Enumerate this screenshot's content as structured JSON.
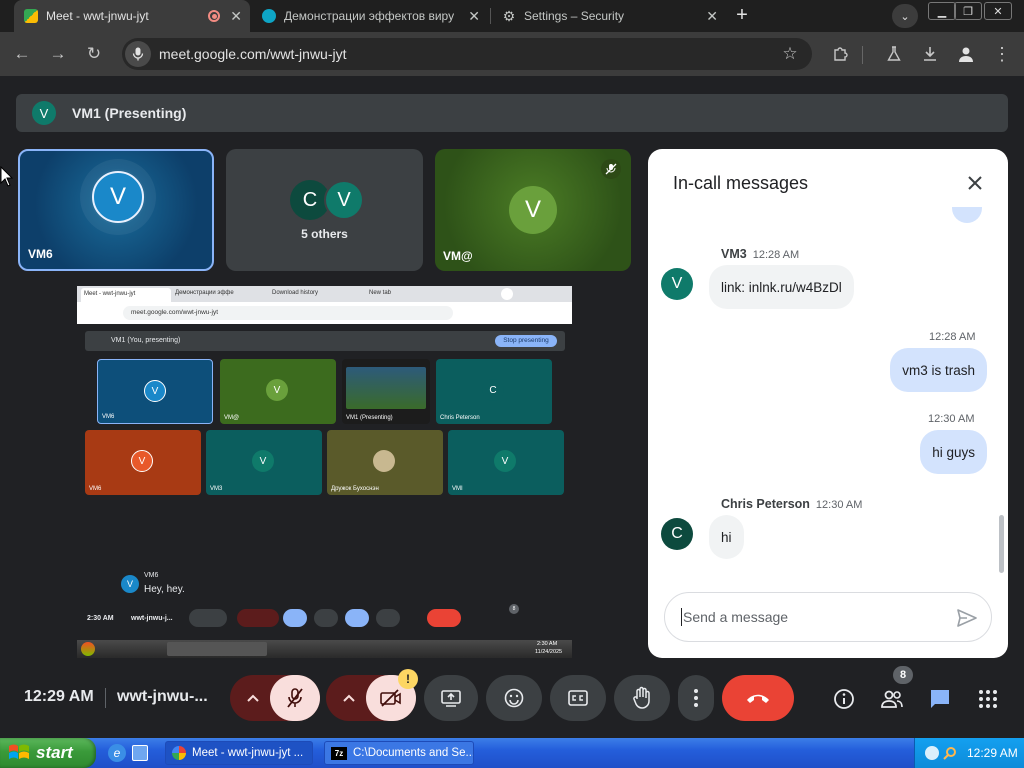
{
  "tabs": [
    {
      "title": "Meet - wwt-jnwu-jyt",
      "active": true
    },
    {
      "title": "Демонстрации эффектов вирусов",
      "active": false
    },
    {
      "title": "Settings – Security",
      "active": false
    }
  ],
  "new_tab_label": "+",
  "address_bar": {
    "url": "meet.google.com/wwt-jnwu-jyt"
  },
  "presenter_bar": {
    "avatar": "V",
    "label": "VM1 (Presenting)"
  },
  "participants": [
    {
      "name": "VM6",
      "avatar": "V"
    },
    {
      "name": "5 others",
      "avatars": [
        "C",
        "V"
      ]
    },
    {
      "name": "VM@",
      "avatar": "V"
    }
  ],
  "shared_screen": {
    "tabs": [
      "Meet - wwt-jnwu-jyt",
      "Демонстрации эффе",
      "Download history",
      "New tab"
    ],
    "url": "meet.google.com/wwt-jnwu-jyt",
    "presenting_label": "VM1 (You, presenting)",
    "stop_label": "Stop presenting",
    "tiles": [
      {
        "name": "VM6",
        "avatar": "V"
      },
      {
        "name": "VM@",
        "avatar": "V"
      },
      {
        "name": "VM1 (Presenting)",
        "avatar": ""
      },
      {
        "name": "Chris Peterson",
        "avatar": "C"
      },
      {
        "name": "VM6",
        "avatar": "V"
      },
      {
        "name": "VM3",
        "avatar": "V"
      },
      {
        "name": "Дружок Бухоснэн",
        "avatar": ""
      },
      {
        "name": "VMI",
        "avatar": "V"
      }
    ],
    "chat_name": "VM6",
    "chat_text": "Hey, hey.",
    "time": "2:30 AM",
    "meeting": "wwt-jnwu-j...",
    "clock": "2:30 AM",
    "date": "11/24/2025",
    "people_count": "8"
  },
  "chat": {
    "title": "In-call messages",
    "messages": [
      {
        "sender": "VM3",
        "time": "12:28 AM",
        "avatar": "V",
        "text": "link: inlnk.ru/w4BzDl",
        "outgoing": false
      },
      {
        "sender": "",
        "time": "12:28 AM",
        "text": "vm3 is trash",
        "outgoing": true
      },
      {
        "sender": "",
        "time": "12:30 AM",
        "text": "hi guys",
        "outgoing": true
      },
      {
        "sender": "Chris Peterson",
        "time": "12:30 AM",
        "avatar": "C",
        "text": "hi",
        "outgoing": false
      }
    ],
    "input_placeholder": "Send a message"
  },
  "controls": {
    "time": "12:29 AM",
    "meeting_code": "wwt-jnwu-...",
    "people_count": "8",
    "camera_warning": "!"
  },
  "taskbar": {
    "start_label": "start",
    "tasks": [
      "Meet - wwt-jnwu-jyt ...",
      "C:\\Documents and Se..."
    ],
    "clock": "12:29 AM"
  },
  "colors": {
    "accent_blue": "#1a73e8",
    "end_call_red": "#ea4335",
    "muted_red": "#f9dedc",
    "tile_teal": "#0b5e5e",
    "tile_green": "#3c6b1e"
  }
}
